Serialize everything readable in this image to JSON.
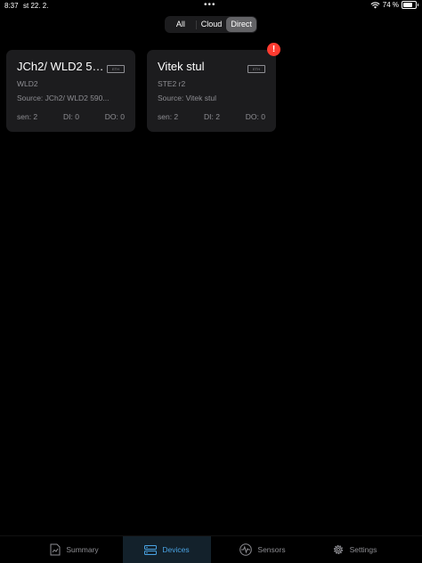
{
  "status_bar": {
    "time": "8:37",
    "date": "st 22. 2.",
    "battery_percent": "74 %",
    "battery_level": 0.74
  },
  "filter": {
    "options": [
      "All",
      "Cloud",
      "Direct"
    ],
    "selected": "Direct"
  },
  "devices": [
    {
      "title": "JCh2/ WLD2 590...",
      "model": "WLD2",
      "source": "Source: JCh2/ WLD2 590...",
      "sen": "sen: 2",
      "di": "DI: 0",
      "do": "DO: 0",
      "alert": false
    },
    {
      "title": "Vitek stul",
      "model": "STE2 r2",
      "source": "Source: Vitek stul",
      "sen": "sen: 2",
      "di": "DI: 2",
      "do": "DO: 0",
      "alert": true,
      "alert_symbol": "!"
    }
  ],
  "tabs": [
    {
      "label": "Summary",
      "icon": "summary-icon",
      "active": false
    },
    {
      "label": "Devices",
      "icon": "devices-icon",
      "active": true
    },
    {
      "label": "Sensors",
      "icon": "sensors-icon",
      "active": false
    },
    {
      "label": "Settings",
      "icon": "settings-icon",
      "active": false
    }
  ],
  "colors": {
    "accent": "#4aa3e3",
    "card_bg": "#1c1c1e",
    "alert": "#ff3b30",
    "secondary_text": "#8e8e93"
  }
}
